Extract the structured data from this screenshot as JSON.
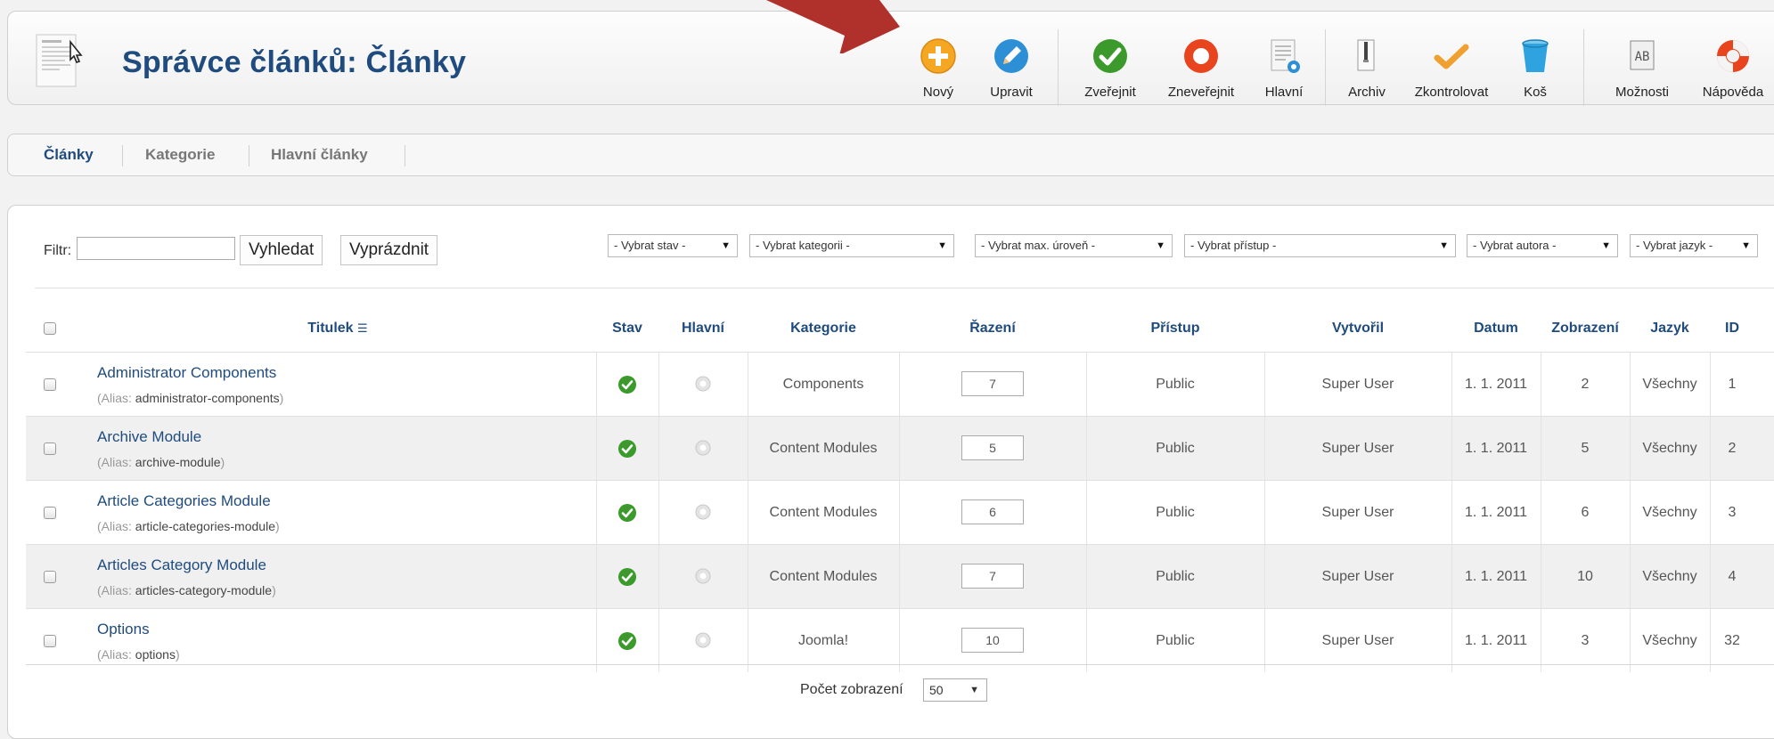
{
  "header": {
    "title": "Správce článků: Články"
  },
  "toolbar": [
    {
      "label": "Nový",
      "icon": "plus-circle-icon",
      "color": "#f5a623"
    },
    {
      "label": "Upravit",
      "icon": "pencil-icon",
      "color": "#2d8fd5"
    },
    {
      "label": "Zveřejnit",
      "icon": "check-circle-icon",
      "color": "#3c9a2c"
    },
    {
      "label": "Zneveřejnit",
      "icon": "stop-circle-icon",
      "color": "#e8441d"
    },
    {
      "label": "Hlavní",
      "icon": "featured-doc-icon",
      "color": "#2d8fd5"
    },
    {
      "label": "Archiv",
      "icon": "archive-icon",
      "color": "#555555"
    },
    {
      "label": "Zkontrolovat",
      "icon": "checkmark-icon",
      "color": "#f0a030"
    },
    {
      "label": "Koš",
      "icon": "trash-icon",
      "color": "#2ea3e0"
    },
    {
      "label": "Možnosti",
      "icon": "options-icon",
      "color": "#666666"
    },
    {
      "label": "Nápověda",
      "icon": "help-lifebuoy-icon",
      "color": "#e8441d"
    }
  ],
  "tabs": [
    {
      "label": "Články",
      "active": true
    },
    {
      "label": "Kategorie",
      "active": false
    },
    {
      "label": "Hlavní články",
      "active": false
    }
  ],
  "filter": {
    "label": "Filtr:",
    "value": "",
    "search_label": "Vyhledat",
    "clear_label": "Vyprázdnit",
    "selects": [
      "- Vybrat stav -",
      "- Vybrat kategorii -",
      "- Vybrat max. úroveň -",
      "- Vybrat přístup -",
      "- Vybrat autora -",
      "- Vybrat jazyk -"
    ]
  },
  "table": {
    "columns": {
      "title": "Titulek",
      "state": "Stav",
      "featured": "Hlavní",
      "category": "Kategorie",
      "ordering": "Řazení",
      "access": "Přístup",
      "author": "Vytvořil",
      "date": "Datum",
      "hits": "Zobrazení",
      "language": "Jazyk",
      "id": "ID"
    },
    "alias_prefix": "(Alias: ",
    "rows": [
      {
        "title": "Administrator Components",
        "alias": "administrator-components",
        "published": true,
        "featured": false,
        "category": "Components",
        "ordering": "7",
        "access": "Public",
        "author": "Super User",
        "date": "1. 1. 2011",
        "hits": "2",
        "language": "Všechny",
        "id": "1"
      },
      {
        "title": "Archive Module",
        "alias": "archive-module",
        "published": true,
        "featured": false,
        "category": "Content Modules",
        "ordering": "5",
        "access": "Public",
        "author": "Super User",
        "date": "1. 1. 2011",
        "hits": "5",
        "language": "Všechny",
        "id": "2"
      },
      {
        "title": "Article Categories Module",
        "alias": "article-categories-module",
        "published": true,
        "featured": false,
        "category": "Content Modules",
        "ordering": "6",
        "access": "Public",
        "author": "Super User",
        "date": "1. 1. 2011",
        "hits": "6",
        "language": "Všechny",
        "id": "3"
      },
      {
        "title": "Articles Category Module",
        "alias": "articles-category-module",
        "published": true,
        "featured": false,
        "category": "Content Modules",
        "ordering": "7",
        "access": "Public",
        "author": "Super User",
        "date": "1. 1. 2011",
        "hits": "10",
        "language": "Všechny",
        "id": "4"
      },
      {
        "title": "Options",
        "alias": "options",
        "published": true,
        "featured": false,
        "category": "Joomla!",
        "ordering": "10",
        "access": "Public",
        "author": "Super User",
        "date": "1. 1. 2011",
        "hits": "3",
        "language": "Všechny",
        "id": "32"
      }
    ]
  },
  "pager": {
    "label": "Počet zobrazení",
    "value": "50"
  },
  "colors": {
    "accent": "#1f4b7e",
    "arrow": "#b0312b",
    "published": "#3c9a2c"
  }
}
